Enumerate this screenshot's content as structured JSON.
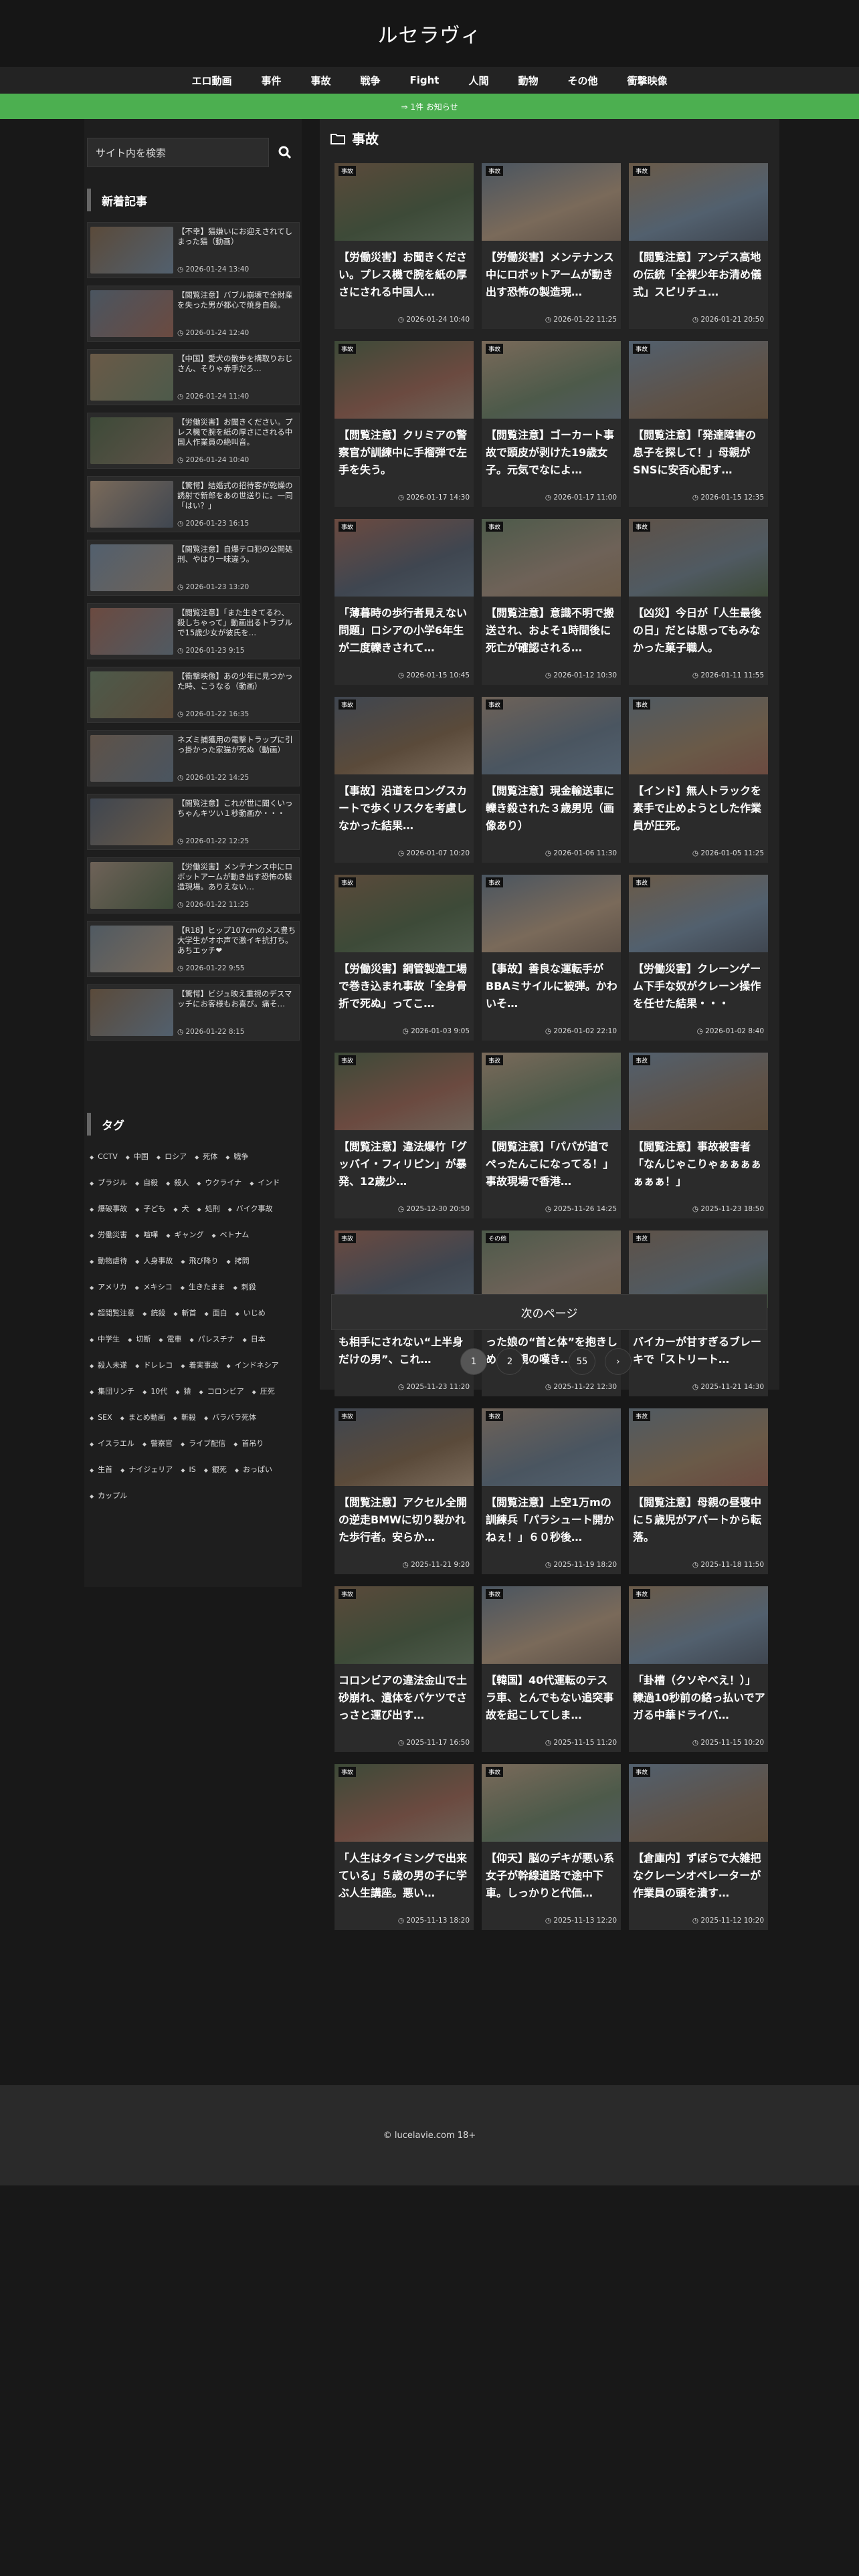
{
  "site": {
    "title": "ルセラヴィ"
  },
  "nav": [
    "エロ動画",
    "事件",
    "事故",
    "戦争",
    "Fight",
    "人間",
    "動物",
    "その他",
    "衝撃映像"
  ],
  "notice": "⇒ 1件 お知らせ",
  "search": {
    "placeholder": "サイト内を検索"
  },
  "sidebar": {
    "recent_heading": "新着記事",
    "recent": [
      {
        "title": "【不幸】猫嫌いにお迎えされてしまった猫（動画）",
        "date": "2026-01-24 13:40"
      },
      {
        "title": "【閲覧注意】バブル崩壊で全財産を失った男が都心で焼身自殺。",
        "date": "2026-01-24 12:40"
      },
      {
        "title": "【中国】愛犬の散歩を構取りおじさん、そりゃ赤手だろ…",
        "date": "2026-01-24 11:40"
      },
      {
        "title": "【労働災害】お聞きください。プレス機で腕を紙の厚さにされる中国人作業員の絶叫音。",
        "date": "2026-01-24 10:40"
      },
      {
        "title": "【驚愕】結婚式の招待客が乾燥の誘射で新郎をあの世送りに。一同「はい？」",
        "date": "2026-01-23 16:15"
      },
      {
        "title": "【閲覧注意】自爆テロ犯の公開処刑、やはり一味違う。",
        "date": "2026-01-23 13:20"
      },
      {
        "title": "【閲覧注意】「また生きてるわ、殺しちゃって」動画出るトラブルで15歳少女が彼氏を…",
        "date": "2026-01-23 9:15"
      },
      {
        "title": "【衝撃映像】あの少年に見つかった時、こうなる（動画）",
        "date": "2026-01-22 16:35"
      },
      {
        "title": "ネズミ捕獲用の電撃トラップに引っ掛かった家猫が死ぬ（動画）",
        "date": "2026-01-22 14:25"
      },
      {
        "title": "【閲覧注意】これが世に聞くいっちゃんキツい１秒動画か・・・",
        "date": "2026-01-22 12:25"
      },
      {
        "title": "【労働災害】メンテナンス中にロボットアームが動き出す恐怖の製造現場。ありえない…",
        "date": "2026-01-22 11:25"
      },
      {
        "title": "【R18】ヒップ107cmのメス豊ち大学生がオホ声で激イキ抗打ち。あちエッチ❤",
        "date": "2026-01-22 9:55"
      },
      {
        "title": "【驚愕】ビジュ映え重視のデスマッチにお客様もお喜び。痛そ…",
        "date": "2026-01-22 8:15"
      }
    ],
    "tags_heading": "タグ",
    "tags": [
      "CCTV",
      "中国",
      "ロシア",
      "死体",
      "戦争",
      "ブラジル",
      "自殺",
      "殺人",
      "ウクライナ",
      "インド",
      "爆破事故",
      "子ども",
      "犬",
      "処刑",
      "バイク事故",
      "労働災害",
      "喧嘩",
      "ギャング",
      "ベトナム",
      "動物虐待",
      "人身事故",
      "飛び降り",
      "拷問",
      "アメリカ",
      "メキシコ",
      "生きたまま",
      "刺殺",
      "超閲覧注意",
      "銃殺",
      "斬首",
      "面白",
      "いじめ",
      "中学生",
      "切断",
      "電車",
      "パレスチナ",
      "日本",
      "殺人未遂",
      "ドレレコ",
      "着実事故",
      "インドネシア",
      "集団リンチ",
      "10代",
      "猿",
      "コロンビア",
      "圧死",
      "SEX",
      "まとめ動画",
      "斬殺",
      "バラバラ死体",
      "イスラエル",
      "警察官",
      "ライブ配信",
      "首吊り",
      "生首",
      "ナイジェリア",
      "IS",
      "銀死",
      "おっぱい",
      "カップル"
    ]
  },
  "main": {
    "heading": "事故",
    "cards": [
      {
        "badge": "事故",
        "title": "【労働災害】お聞きください。プレス機で腕を紙の厚さにされる中国人…",
        "date": "2026-01-24 10:40"
      },
      {
        "badge": "事故",
        "title": "【労働災害】メンテナンス中にロボットアームが動き出す恐怖の製造現…",
        "date": "2026-01-22 11:25"
      },
      {
        "badge": "事故",
        "title": "【閲覧注意】アンデス高地の伝統「全裸少年お清め儀式」スピリチュ…",
        "date": "2026-01-21 20:50"
      },
      {
        "badge": "事故",
        "title": "【閲覧注意】クリミアの警察官が訓練中に手榴弾で左手を失う。",
        "date": "2026-01-17 14:30"
      },
      {
        "badge": "事故",
        "title": "【閲覧注意】ゴーカート事故で頭皮が剥けた19歳女子。元気でなによ…",
        "date": "2026-01-17 11:00"
      },
      {
        "badge": "事故",
        "title": "【閲覧注意】「発達障害の息子を探して！」母親がSNSに安否心配す…",
        "date": "2026-01-15 12:35"
      },
      {
        "badge": "事故",
        "title": "「薄暮時の歩行者見えない問題」ロシアの小学6年生が二度轢きされて…",
        "date": "2026-01-15 10:45"
      },
      {
        "badge": "事故",
        "title": "【閲覧注意】意識不明で搬送され、およそ1時間後に死亡が確認される…",
        "date": "2026-01-12 10:30"
      },
      {
        "badge": "事故",
        "title": "【凶災】今日が「人生最後の日」だとは思ってもみなかった菓子職人。",
        "date": "2026-01-11 11:55"
      },
      {
        "badge": "事故",
        "title": "【事故】沿道をロングスカートで歩くリスクを考慮しなかった結果…",
        "date": "2026-01-07 10:20"
      },
      {
        "badge": "事故",
        "title": "【閲覧注意】現金輸送車に轢き殺された３歳男児（画像あり）",
        "date": "2026-01-06 11:30"
      },
      {
        "badge": "事故",
        "title": "【インド】無人トラックを素手で止めようとした作業員が圧死。",
        "date": "2026-01-05 11:25"
      },
      {
        "badge": "事故",
        "title": "【労働災害】鋼管製造工場で巻き込まれ事故「全身骨折で死ぬ」ってこ…",
        "date": "2026-01-03 9:05"
      },
      {
        "badge": "事故",
        "title": "【事故】善良な運転手がBBAミサイルに被弾。かわいそ…",
        "date": "2026-01-02 22:10"
      },
      {
        "badge": "事故",
        "title": "【労働災害】クレーンゲーム下手な奴がクレーン操作を任せた結果・・・",
        "date": "2026-01-02 8:40"
      },
      {
        "badge": "事故",
        "title": "【閲覧注意】違法爆竹「グッバイ・フィリピン」が暴発、12歳少…",
        "date": "2025-12-30 20:50"
      },
      {
        "badge": "事故",
        "title": "【閲覧注意】「パパが道でぺったんこになってる！」事故現場で香港…",
        "date": "2025-11-26 14:25"
      },
      {
        "badge": "事故",
        "title": "【閲覧注意】事故被害者「なんじゃこりゃぁぁぁぁぁぁぁ！」",
        "date": "2025-11-23 18:50"
      },
      {
        "badge": "事故",
        "title": "【閲覧注意】路上で誰からも相手にされない“上半身だけの男”、これ…",
        "date": "2025-11-23 11:20"
      },
      {
        "badge": "その他",
        "title": "【閲覧注意】事故で亡くなった娘の“首と体”を抱きしめる両親の嘆き…",
        "date": "2025-11-22 12:30"
      },
      {
        "badge": "事故",
        "title": "【悪行】ファンキーな土着バイカーが甘すぎるブレーキで「ストリート…",
        "date": "2025-11-21 14:30"
      },
      {
        "badge": "事故",
        "title": "【閲覧注意】アクセル全開の逆走BMWに切り裂かれた歩行者。安らか…",
        "date": "2025-11-21 9:20"
      },
      {
        "badge": "事故",
        "title": "【閲覧注意】上空1万mの訓練兵「パラシュート開かねぇ！」６０秒後…",
        "date": "2025-11-19 18:20"
      },
      {
        "badge": "事故",
        "title": "【閲覧注意】母親の昼寝中に５歳児がアパートから転落。",
        "date": "2025-11-18 11:50"
      },
      {
        "badge": "事故",
        "title": "コロンビアの違法金山で土砂崩れ、遺体をバケツでさっさと運び出す…",
        "date": "2025-11-17 16:50"
      },
      {
        "badge": "事故",
        "title": "【韓国】40代運転のテスラ車、とんでもない追突事故を起こしてしま…",
        "date": "2025-11-15 11:20"
      },
      {
        "badge": "事故",
        "title": "「卦槽（クソやべえ！）」轢過10秒前の絡っ払いでアガる中華ドライバ…",
        "date": "2025-11-15 10:20"
      },
      {
        "badge": "事故",
        "title": "「人生はタイミングで出来ている」５歳の男の子に学ぶ人生講座。悪い…",
        "date": "2025-11-13 18:20"
      },
      {
        "badge": "事故",
        "title": "【仰天】脳のデキが悪い系女子が幹線道路で途中下車。しっかりと代価…",
        "date": "2025-11-13 12:20"
      },
      {
        "badge": "事故",
        "title": "【倉庫内】ずぼらで大雑把なクレーンオペレーターが作業員の頭を潰す…",
        "date": "2025-11-12 10:20"
      }
    ],
    "next_label": "次のページ",
    "pages": [
      "1",
      "2",
      "…",
      "55",
      "›"
    ]
  },
  "footer": "© lucelavie.com 18+"
}
